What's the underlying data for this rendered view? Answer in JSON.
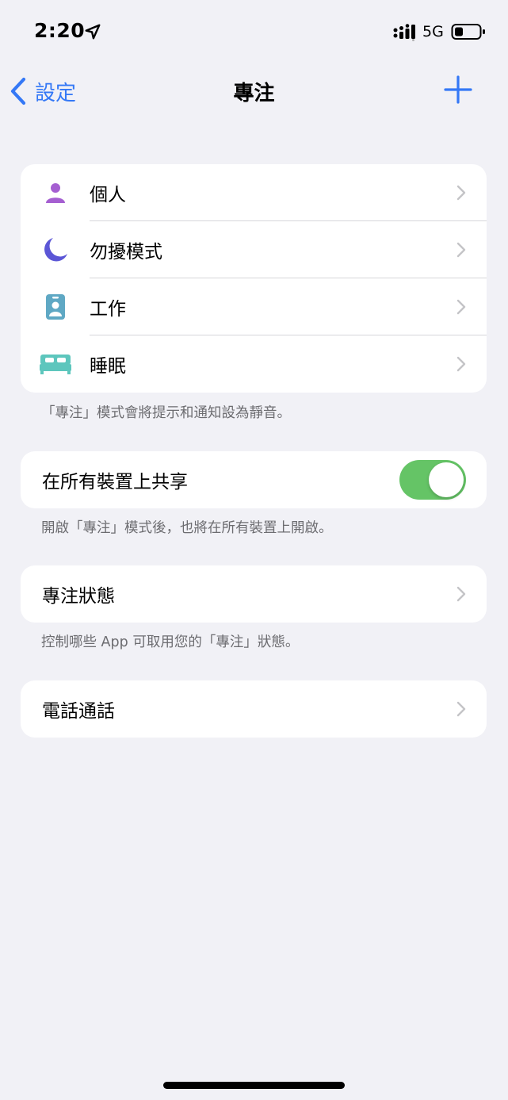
{
  "status_bar": {
    "time": "2:20",
    "network": "5G",
    "icons": [
      "location-arrow-icon",
      "signal-icon",
      "battery-icon"
    ]
  },
  "nav": {
    "back_label": "設定",
    "title": "專注",
    "add_icon": "plus-icon"
  },
  "colors": {
    "accent": "#3478f6",
    "background": "#f1f1f6",
    "toggle_on": "#65c466",
    "personal": "#a55fd1",
    "dnd": "#5b56d6",
    "work": "#5fa8c4",
    "sleep": "#5dc6bd"
  },
  "focus_modes": {
    "items": [
      {
        "label": "個人",
        "icon": "person-icon"
      },
      {
        "label": "勿擾模式",
        "icon": "moon-icon"
      },
      {
        "label": "工作",
        "icon": "id-badge-icon"
      },
      {
        "label": "睡眠",
        "icon": "bed-icon"
      }
    ],
    "footnote": "「專注」模式會將提示和通知設為靜音。"
  },
  "share": {
    "label": "在所有裝置上共享",
    "enabled": true,
    "footnote": "開啟「專注」模式後，也將在所有裝置上開啟。"
  },
  "focus_status": {
    "label": "專注狀態",
    "footnote": "控制哪些 App 可取用您的「專注」狀態。"
  },
  "phone_calls": {
    "label": "電話通話"
  }
}
